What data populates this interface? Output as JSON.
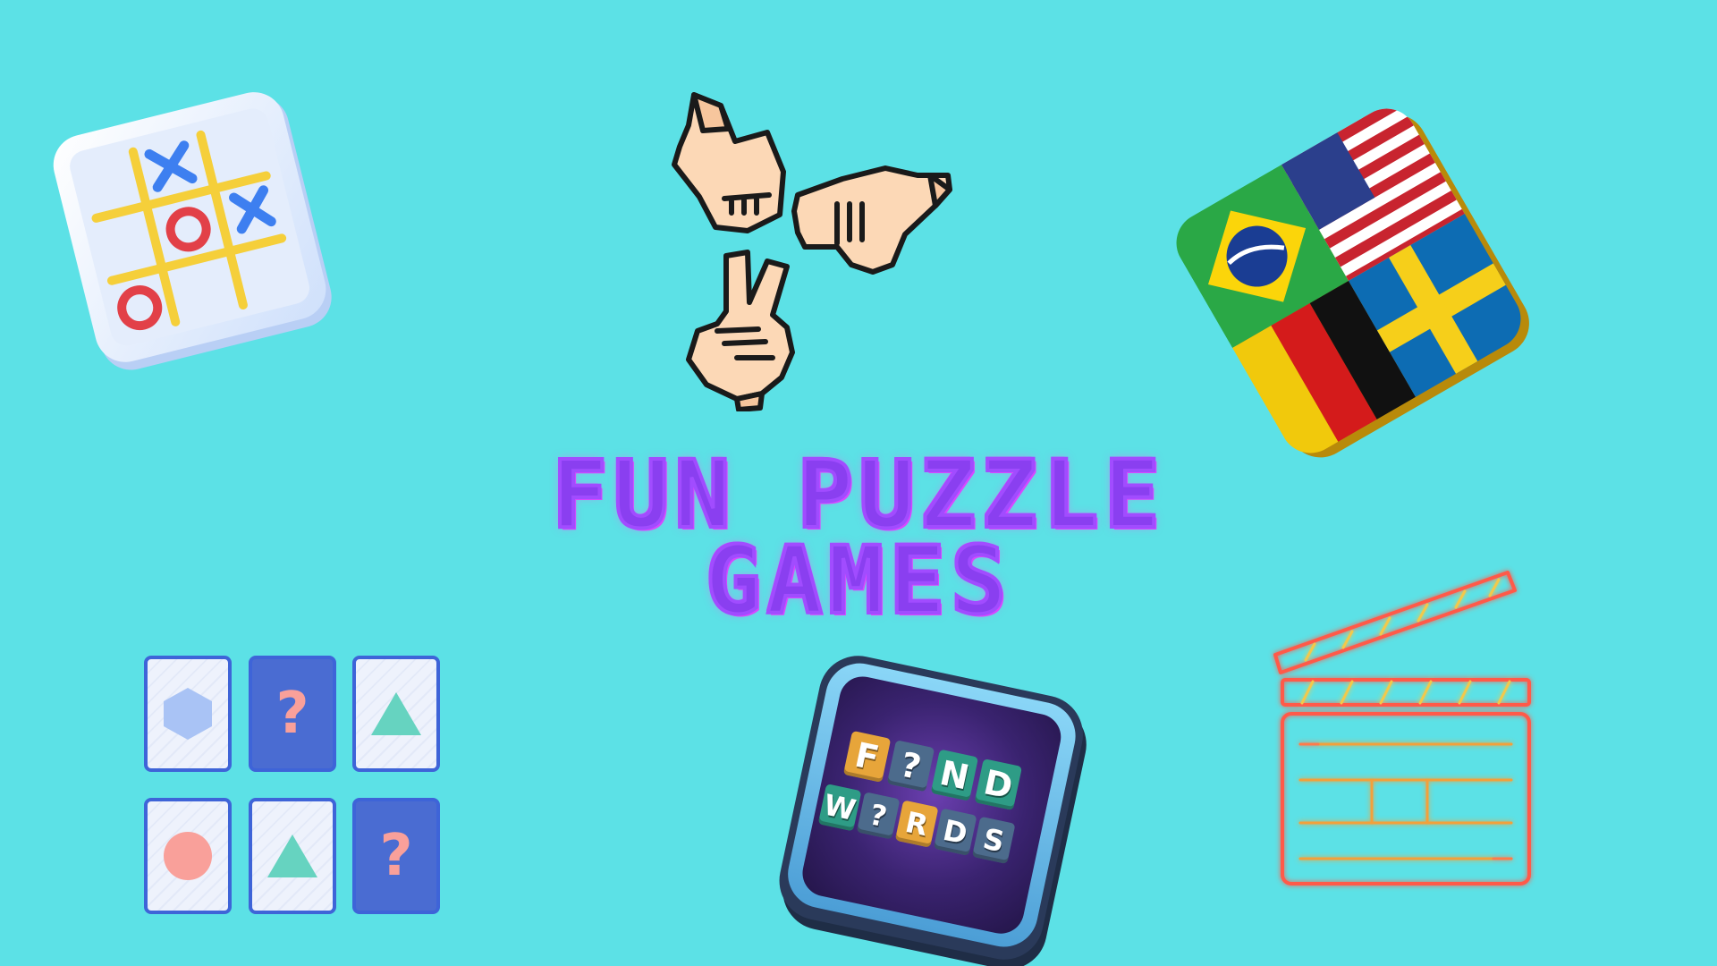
{
  "title": {
    "line1": "FUN PUZZLE",
    "line2": "GAMES"
  },
  "colors": {
    "background": "#5ce1e6",
    "title_fill": "#8a3ff0",
    "title_glow": "#ff6ce0"
  },
  "icons": {
    "tic_tac_toe": "tic-tac-toe-icon",
    "rock_paper_scissors": "rock-paper-scissors-icon",
    "flags": "flags-quiz-icon",
    "memory": "memory-cards-icon",
    "find_words": "find-words-icon",
    "clapperboard": "clapperboard-icon"
  },
  "memory_cards": [
    {
      "type": "hexagon"
    },
    {
      "type": "question",
      "label": "?"
    },
    {
      "type": "triangle"
    },
    {
      "type": "circle"
    },
    {
      "type": "triangle"
    },
    {
      "type": "question",
      "label": "?"
    }
  ],
  "find_words": {
    "row1": [
      "F",
      "?",
      "N",
      "D"
    ],
    "row2": [
      "W",
      "?",
      "R",
      "D",
      "S"
    ]
  }
}
